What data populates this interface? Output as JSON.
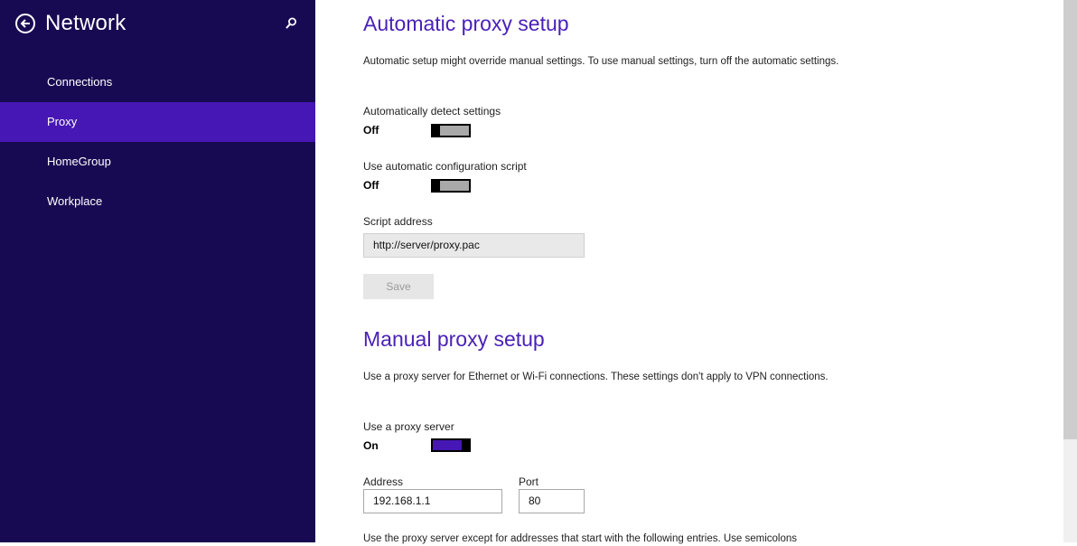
{
  "sidebar": {
    "title": "Network",
    "items": [
      {
        "label": "Connections",
        "selected": false
      },
      {
        "label": "Proxy",
        "selected": true
      },
      {
        "label": "HomeGroup",
        "selected": false
      },
      {
        "label": "Workplace",
        "selected": false
      }
    ]
  },
  "auto": {
    "heading": "Automatic proxy setup",
    "description": "Automatic setup might override manual settings. To use manual settings, turn off the automatic settings.",
    "detect": {
      "label": "Automatically detect settings",
      "state": "Off"
    },
    "script": {
      "label": "Use automatic configuration script",
      "state": "Off"
    },
    "script_address": {
      "label": "Script address",
      "value": "http://server/proxy.pac"
    },
    "save_label": "Save"
  },
  "manual": {
    "heading": "Manual proxy setup",
    "description": "Use a proxy server for Ethernet or Wi-Fi connections. These settings don't apply to VPN connections.",
    "use_proxy": {
      "label": "Use a proxy server",
      "state": "On"
    },
    "address": {
      "label": "Address",
      "value": "192.168.1.1"
    },
    "port": {
      "label": "Port",
      "value": "80"
    },
    "exceptions_text": "Use the proxy server except for addresses that start with the following entries. Use semicolons"
  },
  "colors": {
    "sidebar_bg": "#180a52",
    "selected_bg": "#4617b4",
    "accent": "#4a21b8"
  },
  "icons": {
    "back": "back-arrow-circle-icon",
    "search": "search-icon"
  }
}
